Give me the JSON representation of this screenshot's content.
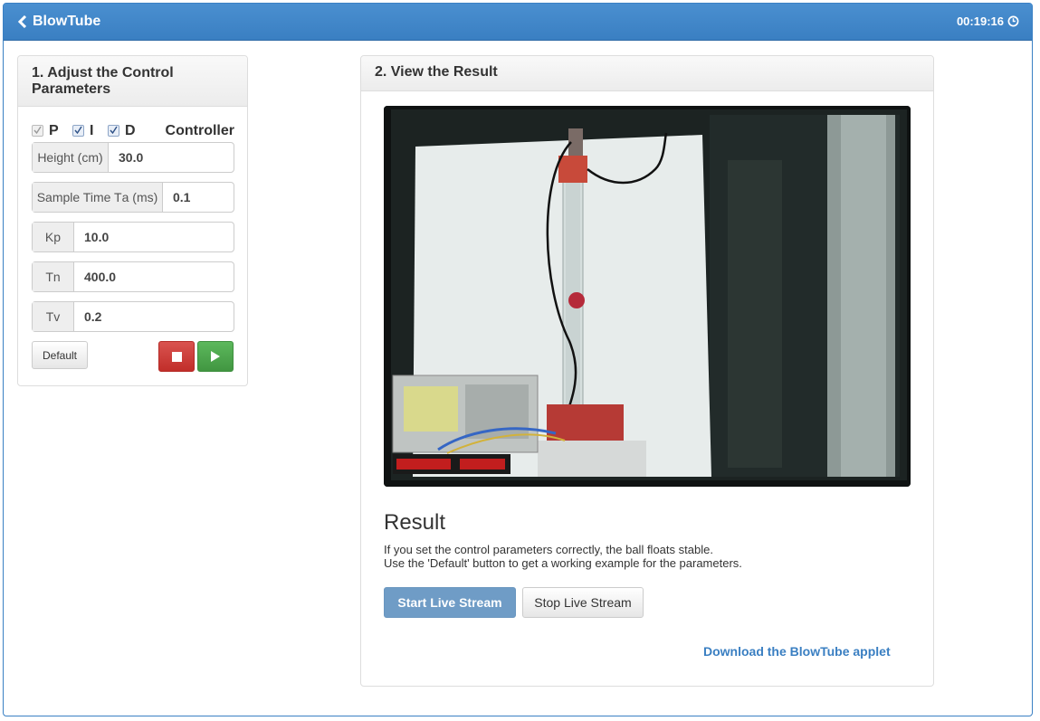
{
  "header": {
    "back_label": "BlowTube",
    "timer": "00:19:16"
  },
  "left_panel": {
    "title": "1. Adjust the Control Parameters",
    "pid": {
      "p_label": "P",
      "i_label": "I",
      "d_label": "D",
      "controller_label": "Controller",
      "p_checked": true,
      "i_checked": true,
      "d_checked": true
    },
    "fields": {
      "height_label": "Height (cm)",
      "height_value": "30.0",
      "sample_label_main": "Sample Time T",
      "sample_label_sub": "a",
      "sample_label_unit": " (ms)",
      "sample_value": "0.1",
      "kp_main": "K",
      "kp_sub": "p",
      "kp_value": "10.0",
      "tn_main": "T",
      "tn_sub": "n",
      "tn_value": "400.0",
      "tv_main": "T",
      "tv_sub": "v",
      "tv_value": "0.2"
    },
    "default_button": "Default",
    "stop_icon": "stop-icon",
    "play_icon": "play-icon"
  },
  "right_panel": {
    "title": "2. View the Result",
    "camera_image": "blowtube-camera-feed",
    "result_heading": "Result",
    "result_line1": "If you set the control parameters correctly, the ball floats stable.",
    "result_line2": "Use the 'Default' button to get a working example for the parameters.",
    "start_stream": "Start Live Stream",
    "stop_stream": "Stop Live Stream",
    "download_link": "Download the BlowTube applet"
  },
  "colors": {
    "brand_blue": "#3a7fc2",
    "stop_red": "#d9534f",
    "play_green": "#5cb85c"
  }
}
